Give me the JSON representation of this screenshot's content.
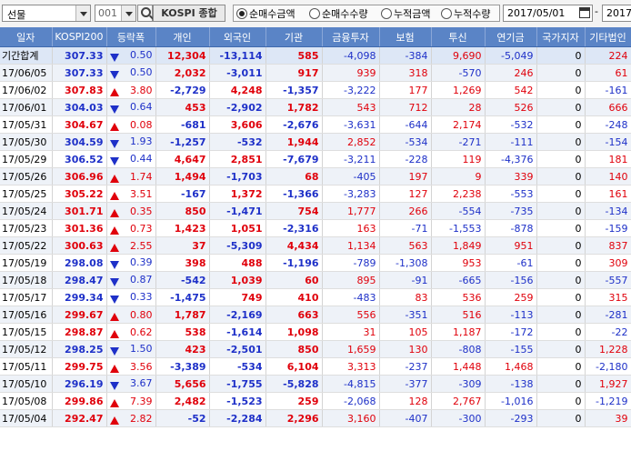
{
  "toolbar": {
    "market_combo": "선물",
    "code_value": "001",
    "index_name": "KOSPI 종합",
    "radios": [
      {
        "label": "순매수금액",
        "selected": true
      },
      {
        "label": "순매수수량",
        "selected": false
      },
      {
        "label": "누적금액",
        "selected": false
      },
      {
        "label": "누적수량",
        "selected": false
      }
    ],
    "date_from": "2017/05/01",
    "date_sep": "-",
    "date_to": "2017"
  },
  "colors": {
    "header_bg": "#5a84c6",
    "up": "#e0000b",
    "down": "#1e30c8"
  },
  "table": {
    "headers": [
      "일자",
      "KOSPI200",
      "등락폭",
      "개인",
      "외국인",
      "기관",
      "금융투자",
      "보험",
      "투신",
      "연기금",
      "국가지자",
      "기타법인"
    ],
    "rows": [
      {
        "date": "기간합계",
        "kospi": "307.33",
        "dir": "down",
        "chg": "0.50",
        "indiv": "12,304",
        "foreign": "-13,114",
        "inst": "585",
        "fin": "-4,098",
        "ins": "-384",
        "trust": "9,690",
        "pension": "-5,049",
        "gov": "0",
        "etc": "224"
      },
      {
        "date": "17/06/05",
        "kospi": "307.33",
        "dir": "down",
        "chg": "0.50",
        "indiv": "2,032",
        "foreign": "-3,011",
        "inst": "917",
        "fin": "939",
        "ins": "318",
        "trust": "-570",
        "pension": "246",
        "gov": "0",
        "etc": "61"
      },
      {
        "date": "17/06/02",
        "kospi": "307.83",
        "dir": "up",
        "chg": "3.80",
        "indiv": "-2,729",
        "foreign": "4,248",
        "inst": "-1,357",
        "fin": "-3,222",
        "ins": "177",
        "trust": "1,269",
        "pension": "542",
        "gov": "0",
        "etc": "-161"
      },
      {
        "date": "17/06/01",
        "kospi": "304.03",
        "dir": "down",
        "chg": "0.64",
        "indiv": "453",
        "foreign": "-2,902",
        "inst": "1,782",
        "fin": "543",
        "ins": "712",
        "trust": "28",
        "pension": "526",
        "gov": "0",
        "etc": "666"
      },
      {
        "date": "17/05/31",
        "kospi": "304.67",
        "dir": "up",
        "chg": "0.08",
        "indiv": "-681",
        "foreign": "3,606",
        "inst": "-2,676",
        "fin": "-3,631",
        "ins": "-644",
        "trust": "2,174",
        "pension": "-532",
        "gov": "0",
        "etc": "-248"
      },
      {
        "date": "17/05/30",
        "kospi": "304.59",
        "dir": "down",
        "chg": "1.93",
        "indiv": "-1,257",
        "foreign": "-532",
        "inst": "1,944",
        "fin": "2,852",
        "ins": "-534",
        "trust": "-271",
        "pension": "-111",
        "gov": "0",
        "etc": "-154"
      },
      {
        "date": "17/05/29",
        "kospi": "306.52",
        "dir": "down",
        "chg": "0.44",
        "indiv": "4,647",
        "foreign": "2,851",
        "inst": "-7,679",
        "fin": "-3,211",
        "ins": "-228",
        "trust": "119",
        "pension": "-4,376",
        "gov": "0",
        "etc": "181"
      },
      {
        "date": "17/05/26",
        "kospi": "306.96",
        "dir": "up",
        "chg": "1.74",
        "indiv": "1,494",
        "foreign": "-1,703",
        "inst": "68",
        "fin": "-405",
        "ins": "197",
        "trust": "9",
        "pension": "339",
        "gov": "0",
        "etc": "140"
      },
      {
        "date": "17/05/25",
        "kospi": "305.22",
        "dir": "up",
        "chg": "3.51",
        "indiv": "-167",
        "foreign": "1,372",
        "inst": "-1,366",
        "fin": "-3,283",
        "ins": "127",
        "trust": "2,238",
        "pension": "-553",
        "gov": "0",
        "etc": "161"
      },
      {
        "date": "17/05/24",
        "kospi": "301.71",
        "dir": "up",
        "chg": "0.35",
        "indiv": "850",
        "foreign": "-1,471",
        "inst": "754",
        "fin": "1,777",
        "ins": "266",
        "trust": "-554",
        "pension": "-735",
        "gov": "0",
        "etc": "-134"
      },
      {
        "date": "17/05/23",
        "kospi": "301.36",
        "dir": "up",
        "chg": "0.73",
        "indiv": "1,423",
        "foreign": "1,051",
        "inst": "-2,316",
        "fin": "163",
        "ins": "-71",
        "trust": "-1,553",
        "pension": "-878",
        "gov": "0",
        "etc": "-159"
      },
      {
        "date": "17/05/22",
        "kospi": "300.63",
        "dir": "up",
        "chg": "2.55",
        "indiv": "37",
        "foreign": "-5,309",
        "inst": "4,434",
        "fin": "1,134",
        "ins": "563",
        "trust": "1,849",
        "pension": "951",
        "gov": "0",
        "etc": "837"
      },
      {
        "date": "17/05/19",
        "kospi": "298.08",
        "dir": "down",
        "chg": "0.39",
        "indiv": "398",
        "foreign": "488",
        "inst": "-1,196",
        "fin": "-789",
        "ins": "-1,308",
        "trust": "953",
        "pension": "-61",
        "gov": "0",
        "etc": "309"
      },
      {
        "date": "17/05/18",
        "kospi": "298.47",
        "dir": "down",
        "chg": "0.87",
        "indiv": "-542",
        "foreign": "1,039",
        "inst": "60",
        "fin": "895",
        "ins": "-91",
        "trust": "-665",
        "pension": "-156",
        "gov": "0",
        "etc": "-557"
      },
      {
        "date": "17/05/17",
        "kospi": "299.34",
        "dir": "down",
        "chg": "0.33",
        "indiv": "-1,475",
        "foreign": "749",
        "inst": "410",
        "fin": "-483",
        "ins": "83",
        "trust": "536",
        "pension": "259",
        "gov": "0",
        "etc": "315"
      },
      {
        "date": "17/05/16",
        "kospi": "299.67",
        "dir": "up",
        "chg": "0.80",
        "indiv": "1,787",
        "foreign": "-2,169",
        "inst": "663",
        "fin": "556",
        "ins": "-351",
        "trust": "516",
        "pension": "-113",
        "gov": "0",
        "etc": "-281"
      },
      {
        "date": "17/05/15",
        "kospi": "298.87",
        "dir": "up",
        "chg": "0.62",
        "indiv": "538",
        "foreign": "-1,614",
        "inst": "1,098",
        "fin": "31",
        "ins": "105",
        "trust": "1,187",
        "pension": "-172",
        "gov": "0",
        "etc": "-22"
      },
      {
        "date": "17/05/12",
        "kospi": "298.25",
        "dir": "down",
        "chg": "1.50",
        "indiv": "423",
        "foreign": "-2,501",
        "inst": "850",
        "fin": "1,659",
        "ins": "130",
        "trust": "-808",
        "pension": "-155",
        "gov": "0",
        "etc": "1,228"
      },
      {
        "date": "17/05/11",
        "kospi": "299.75",
        "dir": "up",
        "chg": "3.56",
        "indiv": "-3,389",
        "foreign": "-534",
        "inst": "6,104",
        "fin": "3,313",
        "ins": "-237",
        "trust": "1,448",
        "pension": "1,468",
        "gov": "0",
        "etc": "-2,180"
      },
      {
        "date": "17/05/10",
        "kospi": "296.19",
        "dir": "down",
        "chg": "3.67",
        "indiv": "5,656",
        "foreign": "-1,755",
        "inst": "-5,828",
        "fin": "-4,815",
        "ins": "-377",
        "trust": "-309",
        "pension": "-138",
        "gov": "0",
        "etc": "1,927"
      },
      {
        "date": "17/05/08",
        "kospi": "299.86",
        "dir": "up",
        "chg": "7.39",
        "indiv": "2,482",
        "foreign": "-1,523",
        "inst": "259",
        "fin": "-2,068",
        "ins": "128",
        "trust": "2,767",
        "pension": "-1,016",
        "gov": "0",
        "etc": "-1,219"
      },
      {
        "date": "17/05/04",
        "kospi": "292.47",
        "dir": "up",
        "chg": "2.82",
        "indiv": "-52",
        "foreign": "-2,284",
        "inst": "2,296",
        "fin": "3,160",
        "ins": "-407",
        "trust": "-300",
        "pension": "-293",
        "gov": "0",
        "etc": "39"
      }
    ]
  }
}
